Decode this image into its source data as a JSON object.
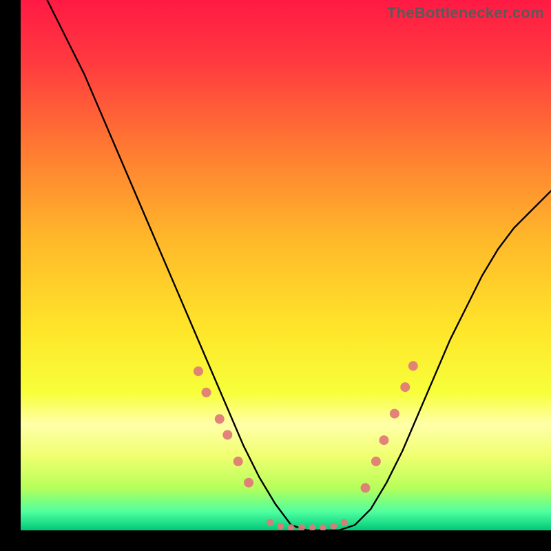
{
  "watermark": "TheBottlenecker.com",
  "chart_data": {
    "type": "line",
    "title": "",
    "xlabel": "",
    "ylabel": "",
    "xlim": [
      0,
      100
    ],
    "ylim": [
      0,
      100
    ],
    "grid": false,
    "background_gradient": {
      "direction": "vertical",
      "stops": [
        {
          "pos": 0.0,
          "color": "#ff1a44"
        },
        {
          "pos": 0.12,
          "color": "#ff3b3f"
        },
        {
          "pos": 0.28,
          "color": "#ff7a32"
        },
        {
          "pos": 0.45,
          "color": "#ffb82a"
        },
        {
          "pos": 0.62,
          "color": "#ffe52a"
        },
        {
          "pos": 0.74,
          "color": "#f7ff3a"
        },
        {
          "pos": 0.8,
          "color": "#ffffa8"
        },
        {
          "pos": 0.86,
          "color": "#f0ff70"
        },
        {
          "pos": 0.92,
          "color": "#b6ff5a"
        },
        {
          "pos": 0.965,
          "color": "#4fffa0"
        },
        {
          "pos": 1.0,
          "color": "#00c878"
        }
      ]
    },
    "series": [
      {
        "name": "bottleneck-curve",
        "color": "#000000",
        "x": [
          0,
          3,
          6,
          9,
          12,
          15,
          18,
          21,
          24,
          27,
          30,
          33,
          36,
          39,
          42,
          45,
          48,
          51,
          54,
          57,
          60,
          63,
          66,
          69,
          72,
          75,
          78,
          81,
          84,
          87,
          90,
          93,
          96,
          100
        ],
        "values": [
          110,
          104,
          98,
          92,
          86,
          79,
          72,
          65,
          58,
          51,
          44,
          37,
          30,
          23,
          16,
          10,
          5,
          1,
          0,
          0,
          0,
          1,
          4,
          9,
          15,
          22,
          29,
          36,
          42,
          48,
          53,
          57,
          60,
          64
        ]
      }
    ],
    "markers": {
      "color": "#e07878",
      "radius_main": 7,
      "radius_small": 5,
      "points": [
        {
          "x": 33.5,
          "y": 30
        },
        {
          "x": 35.0,
          "y": 26
        },
        {
          "x": 37.5,
          "y": 21
        },
        {
          "x": 39.0,
          "y": 18
        },
        {
          "x": 41.0,
          "y": 13
        },
        {
          "x": 43.0,
          "y": 9
        },
        {
          "x": 47.0,
          "y": 1.5
        },
        {
          "x": 49.0,
          "y": 0.8
        },
        {
          "x": 51.0,
          "y": 0.5
        },
        {
          "x": 53.0,
          "y": 0.5
        },
        {
          "x": 55.0,
          "y": 0.5
        },
        {
          "x": 57.0,
          "y": 0.5
        },
        {
          "x": 59.0,
          "y": 0.8
        },
        {
          "x": 61.0,
          "y": 1.5
        },
        {
          "x": 65.0,
          "y": 8
        },
        {
          "x": 67.0,
          "y": 13
        },
        {
          "x": 68.5,
          "y": 17
        },
        {
          "x": 70.5,
          "y": 22
        },
        {
          "x": 72.5,
          "y": 27
        },
        {
          "x": 74.0,
          "y": 31
        }
      ]
    }
  }
}
